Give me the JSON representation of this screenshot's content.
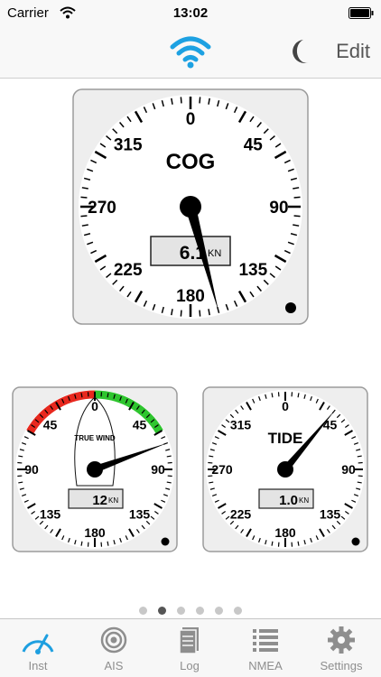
{
  "status": {
    "carrier": "Carrier",
    "time": "13:02"
  },
  "nav": {
    "edit_label": "Edit",
    "accent": "#1da1e2"
  },
  "gauges": {
    "cog": {
      "title": "COG",
      "labels": [
        "0",
        "45",
        "90",
        "135",
        "180",
        "225",
        "270",
        "315"
      ],
      "value": "6.1",
      "unit": "KN",
      "needle_deg": 165
    },
    "wind": {
      "title": "TRUE WIND",
      "labels": [
        "0",
        "45",
        "90",
        "135",
        "180",
        "135",
        "90",
        "45"
      ],
      "value": "12",
      "unit": "KN",
      "needle_deg": 70,
      "port_color": "#e8281e",
      "starboard_color": "#2ec52e"
    },
    "tide": {
      "title": "TIDE",
      "labels": [
        "0",
        "45",
        "90",
        "135",
        "180",
        "225",
        "270",
        "315"
      ],
      "value": "1.0",
      "unit": "KN",
      "needle_deg": 40
    }
  },
  "pager": {
    "count": 6,
    "active": 1
  },
  "tabs": [
    {
      "label": "Inst",
      "icon": "gauge-icon",
      "active": true
    },
    {
      "label": "AIS",
      "icon": "target-icon",
      "active": false
    },
    {
      "label": "Log",
      "icon": "logbook-icon",
      "active": false
    },
    {
      "label": "NMEA",
      "icon": "list-icon",
      "active": false
    },
    {
      "label": "Settings",
      "icon": "gear-icon",
      "active": false
    }
  ]
}
